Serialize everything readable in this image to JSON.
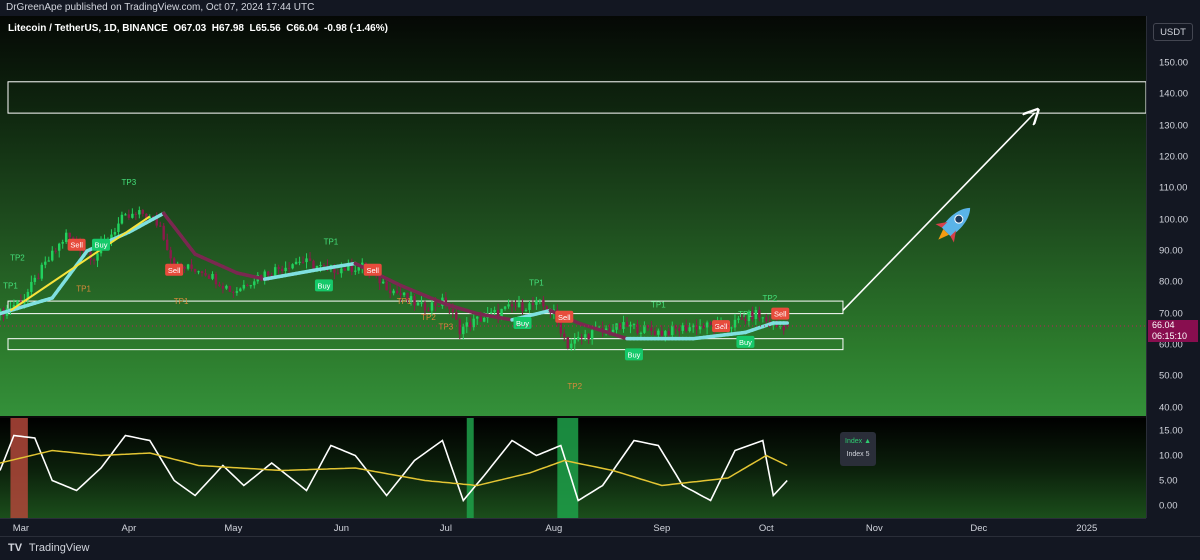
{
  "header": {
    "published_text": "DrGreenApe published on TradingView.com, Oct 07, 2024 17:44 UTC"
  },
  "legend_text": "Litecoin / TetherUS, 1D, BINANCE  O67.03  H67.98  L65.56  C66.04  -0.98 (-1.46%)",
  "currency_unit": "USDT",
  "price_badge": {
    "price": "66.04",
    "countdown": "06:15:10"
  },
  "footer": {
    "brand": "TradingView",
    "logo_glyph": "TV"
  },
  "index_box": {
    "line1": "Index ▲",
    "line2": "Index 5"
  },
  "colors": {
    "bull": "#22d15e",
    "bear": "#8b1a4a",
    "cyan_ma": "#7fe0e0",
    "bear_ma": "#7a2850",
    "yellow": "#f7e33b",
    "oscillator": "#ffffff",
    "osc_signal": "#e3c534",
    "sell_tag": "#e74c3c",
    "buy_tag": "#16c96a",
    "tp_green": "#44e07a",
    "tp_orange": "#d98a3b"
  },
  "icons": {
    "rocket": "rocket-icon"
  },
  "chart_data": [
    {
      "type": "candlestick",
      "title": "Litecoin / TetherUS, 1D, BINANCE",
      "ylabel": "USDT",
      "ylim": [
        37,
        165
      ],
      "y_ticks": [
        40,
        50,
        60,
        70,
        80,
        90,
        100,
        110,
        120,
        130,
        140,
        150
      ],
      "x_ticks": [
        "Mar",
        "Apr",
        "May",
        "Jun",
        "Jul",
        "Aug",
        "Sep",
        "Oct",
        "Nov",
        "Dec",
        "2025"
      ],
      "x_tick_dates": [
        "2024-03-01",
        "2024-04-01",
        "2024-05-01",
        "2024-06-01",
        "2024-07-01",
        "2024-08-01",
        "2024-09-01",
        "2024-10-01",
        "2024-11-01",
        "2024-12-01",
        "2025-01-01"
      ],
      "date_range": [
        "2024-02-24",
        "2025-01-18"
      ],
      "ohlc_last": {
        "open": 67.03,
        "high": 67.98,
        "low": 65.56,
        "close": 66.04,
        "change": -0.98,
        "change_pct": -1.46
      },
      "close_anchors": [
        [
          "2024-02-24",
          70
        ],
        [
          "2024-03-02",
          75
        ],
        [
          "2024-03-07",
          84
        ],
        [
          "2024-03-14",
          95
        ],
        [
          "2024-03-22",
          88
        ],
        [
          "2024-03-30",
          100
        ],
        [
          "2024-04-05",
          102
        ],
        [
          "2024-04-10",
          98
        ],
        [
          "2024-04-14",
          85
        ],
        [
          "2024-04-22",
          84
        ],
        [
          "2024-05-01",
          77
        ],
        [
          "2024-05-08",
          82
        ],
        [
          "2024-05-20",
          87
        ],
        [
          "2024-05-28",
          84
        ],
        [
          "2024-06-07",
          85
        ],
        [
          "2024-06-15",
          78
        ],
        [
          "2024-06-24",
          72
        ],
        [
          "2024-07-01",
          74
        ],
        [
          "2024-07-05",
          65
        ],
        [
          "2024-07-10",
          68
        ],
        [
          "2024-07-20",
          72
        ],
        [
          "2024-07-28",
          73
        ],
        [
          "2024-08-01",
          70
        ],
        [
          "2024-08-05",
          60
        ],
        [
          "2024-08-12",
          64
        ],
        [
          "2024-08-22",
          66
        ],
        [
          "2024-09-01",
          64
        ],
        [
          "2024-09-10",
          66
        ],
        [
          "2024-09-20",
          66
        ],
        [
          "2024-09-28",
          70
        ],
        [
          "2024-10-03",
          66
        ],
        [
          "2024-10-07",
          66.04
        ]
      ],
      "zones": [
        {
          "label": "upper resistance band",
          "y0": 134,
          "y1": 144
        },
        {
          "label": "mid range box",
          "y0": 70,
          "y1": 74
        },
        {
          "label": "support box",
          "y0": 58.5,
          "y1": 62
        }
      ],
      "moving_average": {
        "bull_color": "cyan",
        "bear_color": "maroon",
        "anchors": [
          [
            "2024-02-24",
            70
          ],
          [
            "2024-03-10",
            75
          ],
          [
            "2024-03-20",
            90
          ],
          [
            "2024-04-01",
            96
          ],
          [
            "2024-04-11",
            102
          ],
          [
            "2024-04-20",
            89
          ],
          [
            "2024-05-02",
            83
          ],
          [
            "2024-05-10",
            81
          ],
          [
            "2024-05-25",
            84
          ],
          [
            "2024-06-05",
            86
          ],
          [
            "2024-06-18",
            79
          ],
          [
            "2024-07-01",
            73
          ],
          [
            "2024-07-10",
            70
          ],
          [
            "2024-07-20",
            68
          ],
          [
            "2024-07-31",
            71
          ],
          [
            "2024-08-08",
            67
          ],
          [
            "2024-08-22",
            62
          ],
          [
            "2024-09-10",
            62
          ],
          [
            "2024-09-25",
            64
          ],
          [
            "2024-10-03",
            67
          ],
          [
            "2024-10-07",
            67
          ]
        ]
      },
      "trendlines": [
        {
          "color": "yellow",
          "from": [
            "2024-02-27",
            71
          ],
          "to": [
            "2024-04-07",
            101
          ]
        },
        {
          "color": "white",
          "arrow": true,
          "from": [
            "2024-10-23",
            71
          ],
          "to": [
            "2024-12-17",
            134
          ]
        }
      ],
      "signals": [
        {
          "text": "Sell",
          "kind": "sell",
          "date": "2024-03-17",
          "price": 92
        },
        {
          "text": "Buy",
          "kind": "buy",
          "date": "2024-03-24",
          "price": 92
        },
        {
          "text": "Sell",
          "kind": "sell",
          "date": "2024-04-14",
          "price": 84
        },
        {
          "text": "Buy",
          "kind": "buy",
          "date": "2024-05-27",
          "price": 79
        },
        {
          "text": "Sell",
          "kind": "sell",
          "date": "2024-06-10",
          "price": 84
        },
        {
          "text": "Buy",
          "kind": "buy",
          "date": "2024-07-23",
          "price": 67
        },
        {
          "text": "Sell",
          "kind": "sell",
          "date": "2024-08-04",
          "price": 69
        },
        {
          "text": "Buy",
          "kind": "buy",
          "date": "2024-08-24",
          "price": 57
        },
        {
          "text": "Sell",
          "kind": "sell",
          "date": "2024-09-18",
          "price": 66
        },
        {
          "text": "Buy",
          "kind": "buy",
          "date": "2024-09-25",
          "price": 61
        },
        {
          "text": "Sell",
          "kind": "sell",
          "date": "2024-10-05",
          "price": 70
        }
      ],
      "take_profits": [
        {
          "text": "TP1",
          "kind": "green",
          "date": "2024-02-27",
          "price": 78
        },
        {
          "text": "TP2",
          "kind": "green",
          "date": "2024-02-29",
          "price": 87
        },
        {
          "text": "TP3",
          "kind": "green",
          "date": "2024-04-01",
          "price": 111
        },
        {
          "text": "TP1",
          "kind": "orange",
          "date": "2024-03-19",
          "price": 77
        },
        {
          "text": "TP1",
          "kind": "orange",
          "date": "2024-04-16",
          "price": 73
        },
        {
          "text": "TP1",
          "kind": "green",
          "date": "2024-05-29",
          "price": 92
        },
        {
          "text": "TP1",
          "kind": "orange",
          "date": "2024-06-19",
          "price": 73
        },
        {
          "text": "TP2",
          "kind": "orange",
          "date": "2024-06-26",
          "price": 68
        },
        {
          "text": "TP3",
          "kind": "orange",
          "date": "2024-07-01",
          "price": 65
        },
        {
          "text": "TP1",
          "kind": "green",
          "date": "2024-07-27",
          "price": 79
        },
        {
          "text": "TP2",
          "kind": "orange",
          "date": "2024-08-07",
          "price": 46
        },
        {
          "text": "TP1",
          "kind": "green",
          "date": "2024-08-31",
          "price": 72
        },
        {
          "text": "TP1",
          "kind": "green",
          "date": "2024-09-25",
          "price": 69
        },
        {
          "text": "TP2",
          "kind": "green",
          "date": "2024-10-02",
          "price": 74
        }
      ]
    },
    {
      "type": "line",
      "title": "",
      "ylim": [
        -2.5,
        17.5
      ],
      "y_ticks": [
        0,
        5,
        10,
        15
      ],
      "y_tick_labels": [
        "0.00",
        "5.00",
        "10.00",
        "15.00"
      ],
      "series": [
        {
          "name": "",
          "color": "white",
          "anchors": [
            [
              "2024-02-24",
              7
            ],
            [
              "2024-02-28",
              14
            ],
            [
              "2024-03-05",
              13.5
            ],
            [
              "2024-03-10",
              5
            ],
            [
              "2024-03-17",
              3
            ],
            [
              "2024-03-24",
              7.5
            ],
            [
              "2024-03-31",
              14
            ],
            [
              "2024-04-07",
              13
            ],
            [
              "2024-04-14",
              5
            ],
            [
              "2024-04-20",
              2
            ],
            [
              "2024-04-28",
              8
            ],
            [
              "2024-05-04",
              4
            ],
            [
              "2024-05-12",
              8.5
            ],
            [
              "2024-05-22",
              3
            ],
            [
              "2024-05-29",
              12
            ],
            [
              "2024-06-05",
              10
            ],
            [
              "2024-06-14",
              2
            ],
            [
              "2024-06-22",
              9
            ],
            [
              "2024-06-30",
              13
            ],
            [
              "2024-07-06",
              1
            ],
            [
              "2024-07-12",
              6
            ],
            [
              "2024-07-20",
              13
            ],
            [
              "2024-07-27",
              10
            ],
            [
              "2024-08-03",
              12
            ],
            [
              "2024-08-08",
              1
            ],
            [
              "2024-08-15",
              4
            ],
            [
              "2024-08-24",
              13
            ],
            [
              "2024-08-31",
              12
            ],
            [
              "2024-09-07",
              4
            ],
            [
              "2024-09-15",
              1
            ],
            [
              "2024-09-22",
              11
            ],
            [
              "2024-09-30",
              13
            ],
            [
              "2024-10-03",
              2
            ],
            [
              "2024-10-07",
              5
            ]
          ]
        },
        {
          "name": "",
          "color": "yellow",
          "anchors": [
            [
              "2024-02-24",
              8.5
            ],
            [
              "2024-03-10",
              11
            ],
            [
              "2024-03-24",
              10
            ],
            [
              "2024-04-07",
              10.5
            ],
            [
              "2024-04-21",
              8
            ],
            [
              "2024-05-15",
              7
            ],
            [
              "2024-06-05",
              7.5
            ],
            [
              "2024-06-25",
              5
            ],
            [
              "2024-07-10",
              4
            ],
            [
              "2024-07-25",
              6.5
            ],
            [
              "2024-08-04",
              9
            ],
            [
              "2024-08-18",
              7
            ],
            [
              "2024-09-01",
              4
            ],
            [
              "2024-09-20",
              5.5
            ],
            [
              "2024-10-01",
              10
            ],
            [
              "2024-10-07",
              8
            ]
          ]
        }
      ],
      "highlights": [
        {
          "color": "red",
          "from": "2024-02-27",
          "to": "2024-03-03"
        },
        {
          "color": "green",
          "from": "2024-07-07",
          "to": "2024-07-09"
        },
        {
          "color": "green",
          "from": "2024-08-02",
          "to": "2024-08-08"
        }
      ]
    }
  ]
}
